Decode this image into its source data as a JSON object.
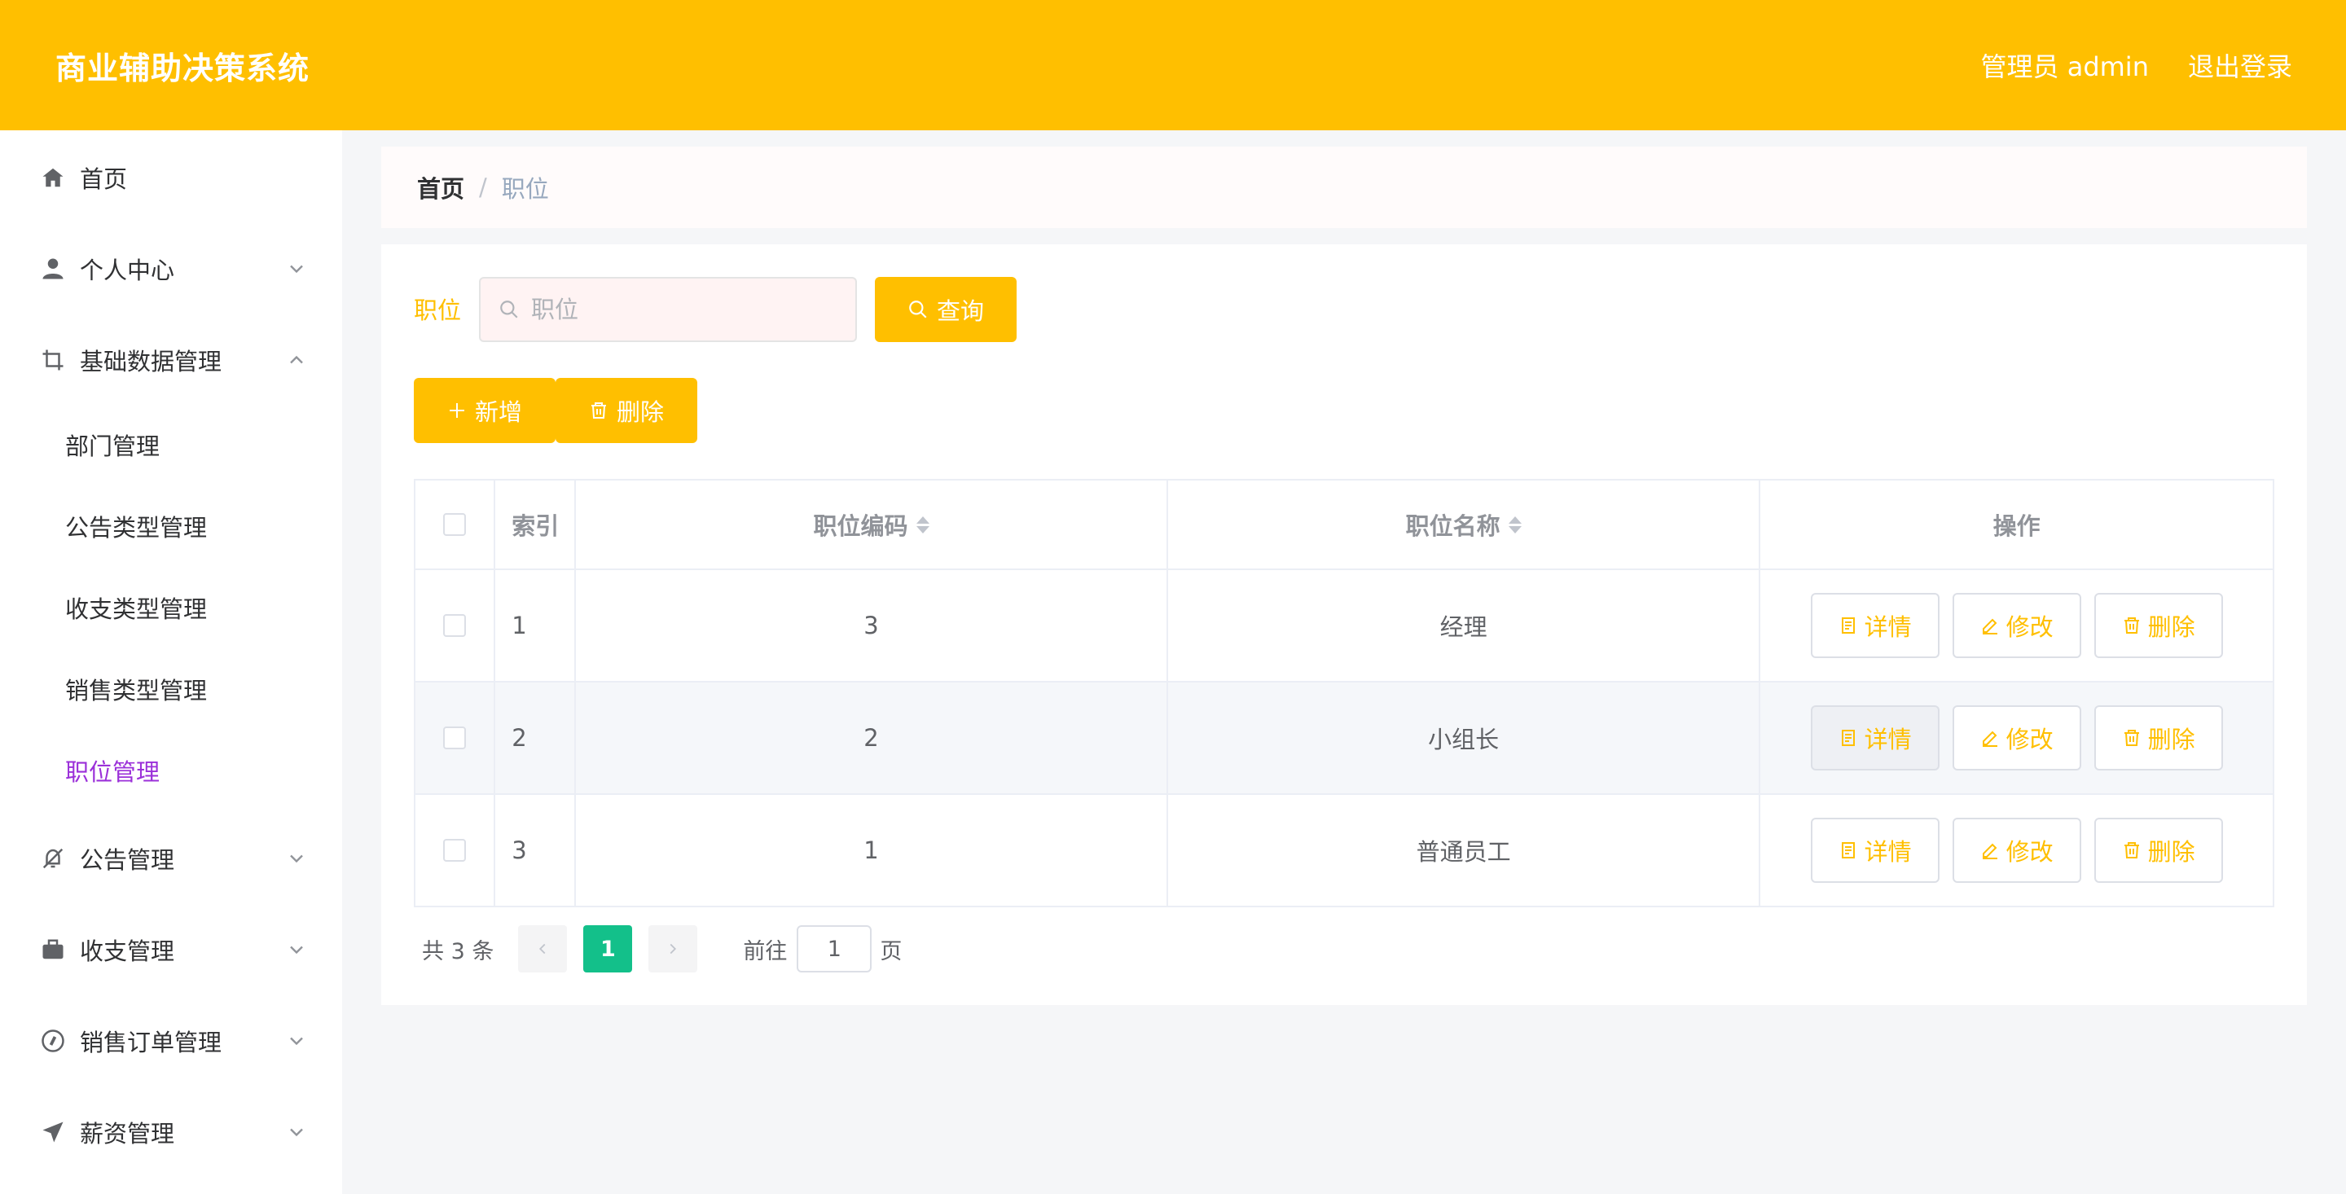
{
  "header": {
    "title": "商业辅助决策系统",
    "user": "管理员 admin",
    "logout": "退出登录"
  },
  "sidebar": {
    "items": [
      {
        "label": "首页",
        "icon": "home-icon"
      },
      {
        "label": "个人中心",
        "icon": "user-icon"
      },
      {
        "label": "基础数据管理",
        "icon": "crop-icon"
      },
      {
        "label": "公告管理",
        "icon": "bell-off-icon"
      },
      {
        "label": "收支管理",
        "icon": "briefcase-icon"
      },
      {
        "label": "销售订单管理",
        "icon": "compass-icon"
      },
      {
        "label": "薪资管理",
        "icon": "send-icon"
      }
    ],
    "subitems": [
      "部门管理",
      "公告类型管理",
      "收支类型管理",
      "销售类型管理",
      "职位管理"
    ],
    "active_color": "#9b30d9"
  },
  "breadcrumb": {
    "home": "首页",
    "separator": "/",
    "current": "职位"
  },
  "search": {
    "label": "职位",
    "placeholder": "职位",
    "query_label": "查询"
  },
  "actions": {
    "add_label": "新增",
    "delete_label": "删除"
  },
  "table": {
    "headers": {
      "index": "索引",
      "code": "职位编码",
      "name": "职位名称",
      "ops": "操作"
    },
    "rows": [
      {
        "index": "1",
        "code": "3",
        "name": "经理"
      },
      {
        "index": "2",
        "code": "2",
        "name": "小组长"
      },
      {
        "index": "3",
        "code": "1",
        "name": "普通员工"
      }
    ],
    "op_labels": {
      "detail": "详情",
      "edit": "修改",
      "delete": "删除"
    }
  },
  "pagination": {
    "total": "共 3 条",
    "current": "1",
    "goto": "前往",
    "goto_value": "1",
    "page_suffix": "页"
  },
  "colors": {
    "primary": "#ffbf00",
    "page_active": "#13c08a"
  }
}
